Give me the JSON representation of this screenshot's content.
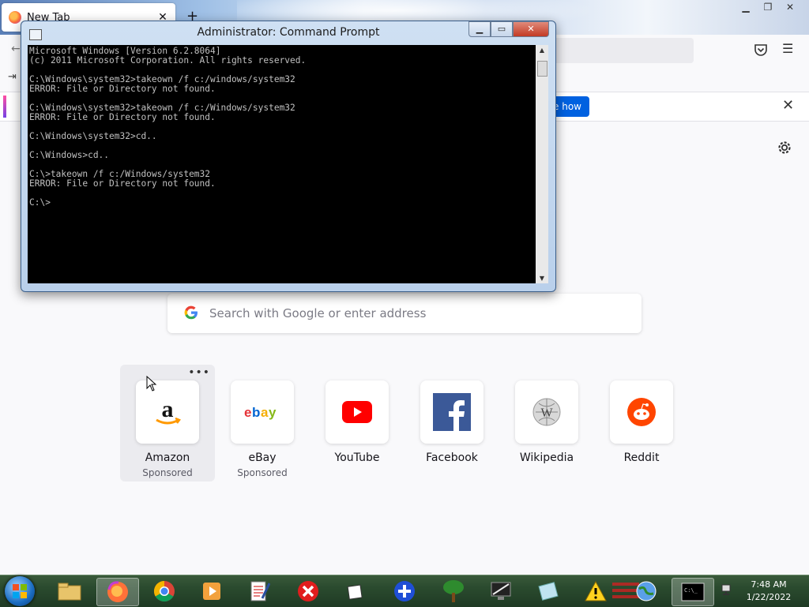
{
  "browser": {
    "tab_title": "New Tab",
    "tab_close": "✕",
    "new_tab": "+",
    "notice_button": "e how",
    "search_placeholder": "Search with Google or enter address",
    "top_sites": [
      {
        "name": "Amazon",
        "sponsored": "Sponsored"
      },
      {
        "name": "eBay",
        "sponsored": "Sponsored"
      },
      {
        "name": "YouTube",
        "sponsored": ""
      },
      {
        "name": "Facebook",
        "sponsored": ""
      },
      {
        "name": "Wikipedia",
        "sponsored": ""
      },
      {
        "name": "Reddit",
        "sponsored": ""
      }
    ],
    "tile_menu": "•••"
  },
  "cmd": {
    "title": "Administrator: Command Prompt",
    "output": "Microsoft Windows [Version 6.2.8064]\n(c) 2011 Microsoft Corporation. All rights reserved.\n\nC:\\Windows\\system32>takeown /f c:/windows/system32\nERROR: File or Directory not found.\n\nC:\\Windows\\system32>takeown /f c:/Windows/system32\nERROR: File or Directory not found.\n\nC:\\Windows\\system32>cd..\n\nC:\\Windows>cd..\n\nC:\\>takeown /f c:/Windows/system32\nERROR: File or Directory not found.\n\nC:\\>"
  },
  "taskbar": {
    "time": "7:48 AM",
    "date": "1/22/2022",
    "pinned": [
      "explorer-icon",
      "firefox-icon",
      "chrome-icon",
      "media-player-icon",
      "notepad-icon",
      "red-x-icon",
      "window-icon",
      "plus-icon",
      "tree-icon",
      "monitor-icon",
      "glass-icon",
      "warning-icon",
      "flag-icon",
      "globe-icon",
      "cmd-icon"
    ]
  }
}
